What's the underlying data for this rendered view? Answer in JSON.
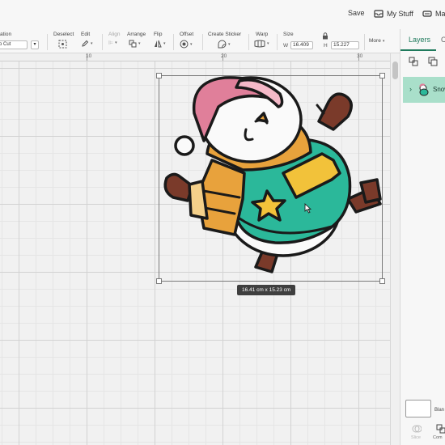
{
  "header": {
    "save_label": "Save",
    "my_stuff_label": "My Stuff",
    "make_label": "Mak"
  },
  "toolbar": {
    "operation_label": "ation",
    "operation_value": "o Cut",
    "deselect_label": "Deselect",
    "edit_label": "Edit",
    "align_label": "Align",
    "arrange_label": "Arrange",
    "flip_label": "Flip",
    "offset_label": "Offset",
    "create_sticker_label": "Create Sticker",
    "warp_label": "Warp",
    "size_label": "Size",
    "width_letter": "W",
    "width_value": "16.409",
    "height_letter": "H",
    "height_value": "15.227",
    "more_label": "More"
  },
  "ruler": {
    "labels": [
      "10",
      "20",
      "30"
    ]
  },
  "canvas": {
    "dimension_label": "16.41  cm x 15.23  cm"
  },
  "layers_panel": {
    "tab_layers": "Layers",
    "tab_color": "C",
    "layer_name": "Snow",
    "blank_label": "Blan",
    "slice_label": "Slice",
    "combine_label": "Com"
  },
  "colors": {
    "accent_green": "#1f7a5c",
    "layer_highlight": "#a9dfca",
    "sweater_teal": "#2bb89a",
    "scarf_orange": "#e8a23c",
    "hat_pink": "#e07f9a",
    "star_yellow": "#f2c23a",
    "mitten_brown": "#7a3a2a"
  }
}
